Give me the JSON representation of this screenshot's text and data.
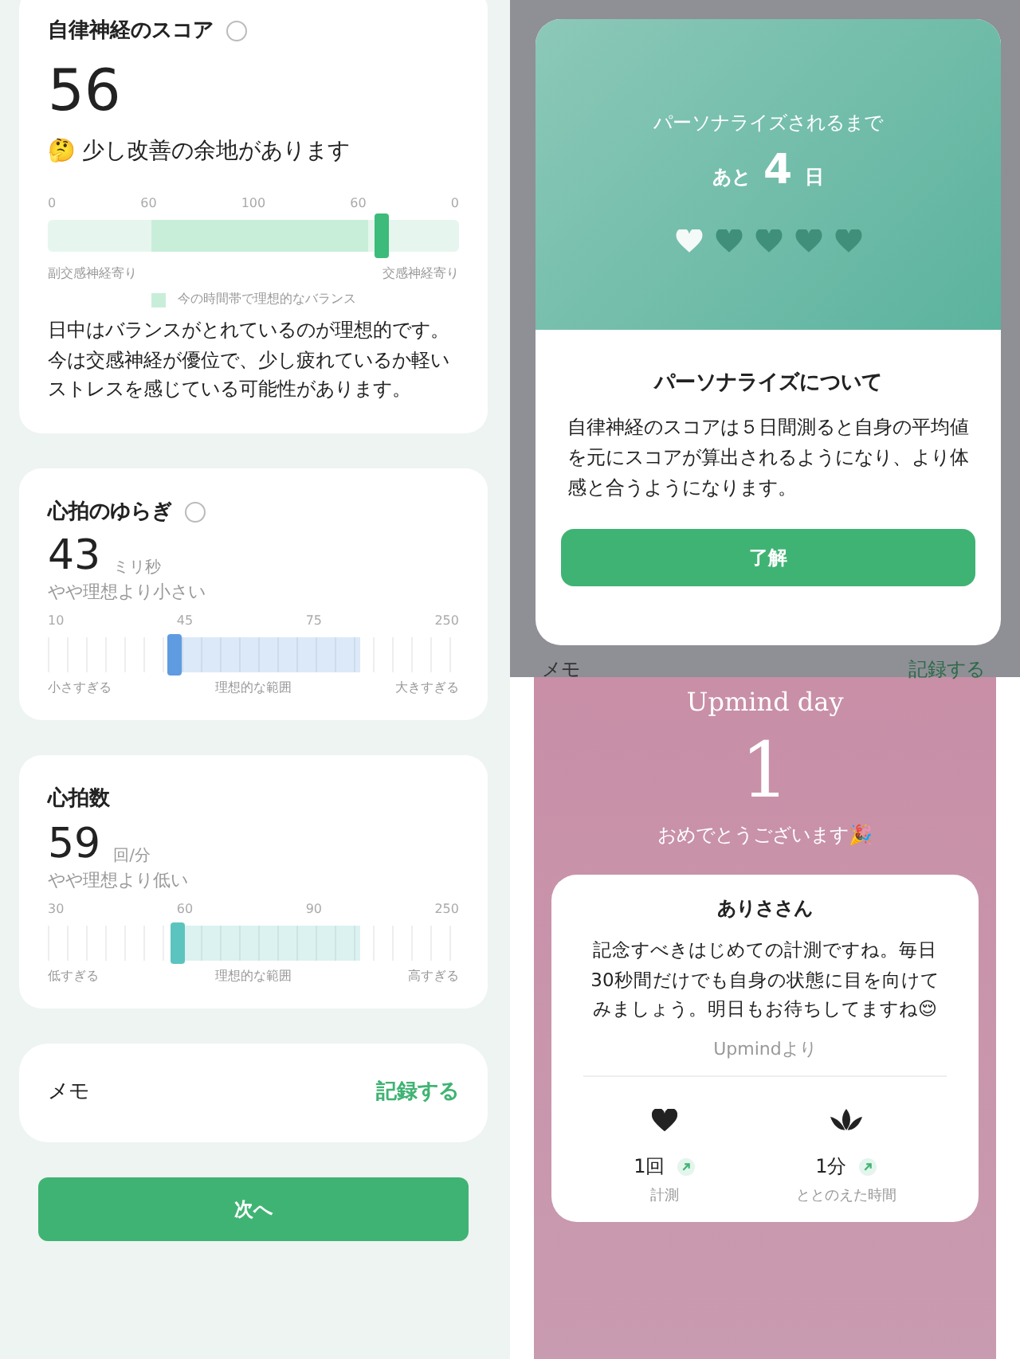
{
  "left": {
    "score_card": {
      "title": "自律神経のスコア",
      "info": true,
      "value": "56",
      "status": "🤔 少し改善の余地があります",
      "scale_labels": [
        "0",
        "60",
        "100",
        "60",
        "0"
      ],
      "level": 0.81,
      "side_labels": [
        "副交感神経寄り",
        "交感神経寄り"
      ],
      "legend": "今の時間帯で理想的なバランス",
      "description": [
        "日中はバランスがとれているのが理想的です。",
        "今は交感神経が優位で、少し疲れているか軽いストレスを感じている可能性があります。"
      ]
    },
    "metrics": [
      {
        "title": "心拍のゆらぎ",
        "info": true,
        "value": "43",
        "unit": "ミリ秒",
        "assessment": "やや理想より小さい",
        "scale_labels": [
          "10",
          "45",
          "75",
          "250"
        ],
        "level": 0.29,
        "range_labels": [
          "小さすぎる",
          "理想的な範囲",
          "大きすぎる"
        ],
        "color": "#5f9be0"
      },
      {
        "title": "心拍数",
        "info": false,
        "value": "59",
        "unit": "回/分",
        "assessment": "やや理想より低い",
        "scale_labels": [
          "30",
          "60",
          "90",
          "250"
        ],
        "level": 0.3,
        "range_labels": [
          "低すぎる",
          "理想的な範囲",
          "高すぎる"
        ],
        "color": "#5cc4bf"
      }
    ],
    "memo": {
      "label": "メモ",
      "action": "記録する"
    },
    "next_button": "次へ"
  },
  "right_top": {
    "modal": {
      "caption": "パーソナライズされるまで",
      "prefix": "あと",
      "days": "4",
      "suffix": "日",
      "hearts": [
        {
          "filled": true
        },
        {
          "filled": false
        },
        {
          "filled": false
        },
        {
          "filled": false
        },
        {
          "filled": false
        }
      ],
      "title": "パーソナライズについて",
      "body": "自律神経のスコアは５日間測ると自身の平均値を元にスコアが算出されるようになり、より体感と合うようになります。",
      "ok_button": "了解"
    },
    "behind": {
      "memo_label": "メモ",
      "memo_action": "記録する"
    }
  },
  "right_bottom": {
    "title": "Upmind day",
    "day": "1",
    "congrats": "おめでとうございます🎉",
    "card": {
      "name": "ありささん",
      "message": "記念すべきはじめての計測ですね。毎日30秒間だけでも自身の状態に目を向けてみましょう。明日もお待ちしてますね😌",
      "signature": "Upmindより",
      "stats": [
        {
          "kind": "heart",
          "value": "1回",
          "label": "計測"
        },
        {
          "kind": "lotus",
          "value": "1分",
          "label": "ととのえた時間"
        }
      ]
    }
  }
}
